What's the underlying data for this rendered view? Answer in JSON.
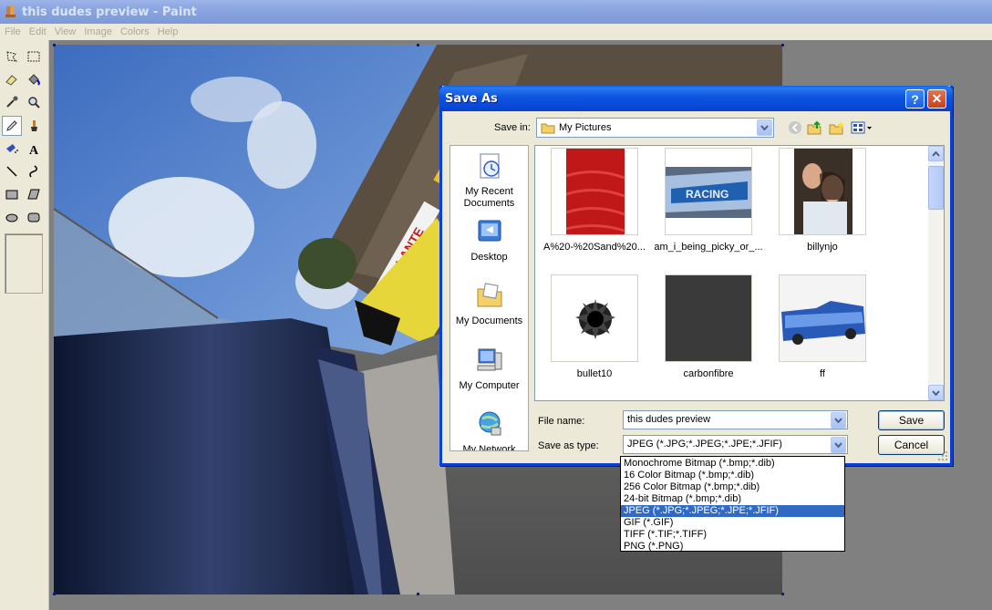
{
  "window": {
    "title": "this dudes preview - Paint"
  },
  "menu": [
    "File",
    "Edit",
    "View",
    "Image",
    "Colors",
    "Help"
  ],
  "dialog": {
    "title": "Save As",
    "save_in_label": "Save in:",
    "save_in_value": "My Pictures",
    "places": [
      "My Recent Documents",
      "Desktop",
      "My Documents",
      "My Computer",
      "My Network"
    ],
    "files": [
      {
        "name": "A%20-%20Sand%20...",
        "thumb": "red-sand-image"
      },
      {
        "name": "am_i_being_picky_or_...",
        "thumb": "racing-car-image"
      },
      {
        "name": "billynjo",
        "thumb": "portrait-photo"
      },
      {
        "name": "bullet10",
        "thumb": "bullet-hole-image"
      },
      {
        "name": "carbonfibre",
        "thumb": "carbon-fibre-image"
      },
      {
        "name": "ff",
        "thumb": "blue-convertible-image"
      }
    ],
    "file_name_label": "File name:",
    "file_name_value": "this dudes preview",
    "file_type_label": "Save as type:",
    "file_type_value": "JPEG (*.JPG;*.JPEG;*.JPE;*.JFIF)",
    "save_button": "Save",
    "cancel_button": "Cancel",
    "type_options": [
      "Monochrome Bitmap (*.bmp;*.dib)",
      "16 Color Bitmap (*.bmp;*.dib)",
      "256 Color Bitmap (*.bmp;*.dib)",
      "24-bit Bitmap (*.bmp;*.dib)",
      "JPEG (*.JPG;*.JPEG;*.JPE;*.JFIF)",
      "GIF (*.GIF)",
      "TIFF (*.TIF;*.TIFF)",
      "PNG (*.PNG)"
    ],
    "selected_type_index": 4
  },
  "canvas": {
    "image": "racing-game-screenshot"
  },
  "colors": {
    "xp_blue": "#0841d8",
    "selection": "#316ac5",
    "dialog_bg": "#ece9d8"
  }
}
